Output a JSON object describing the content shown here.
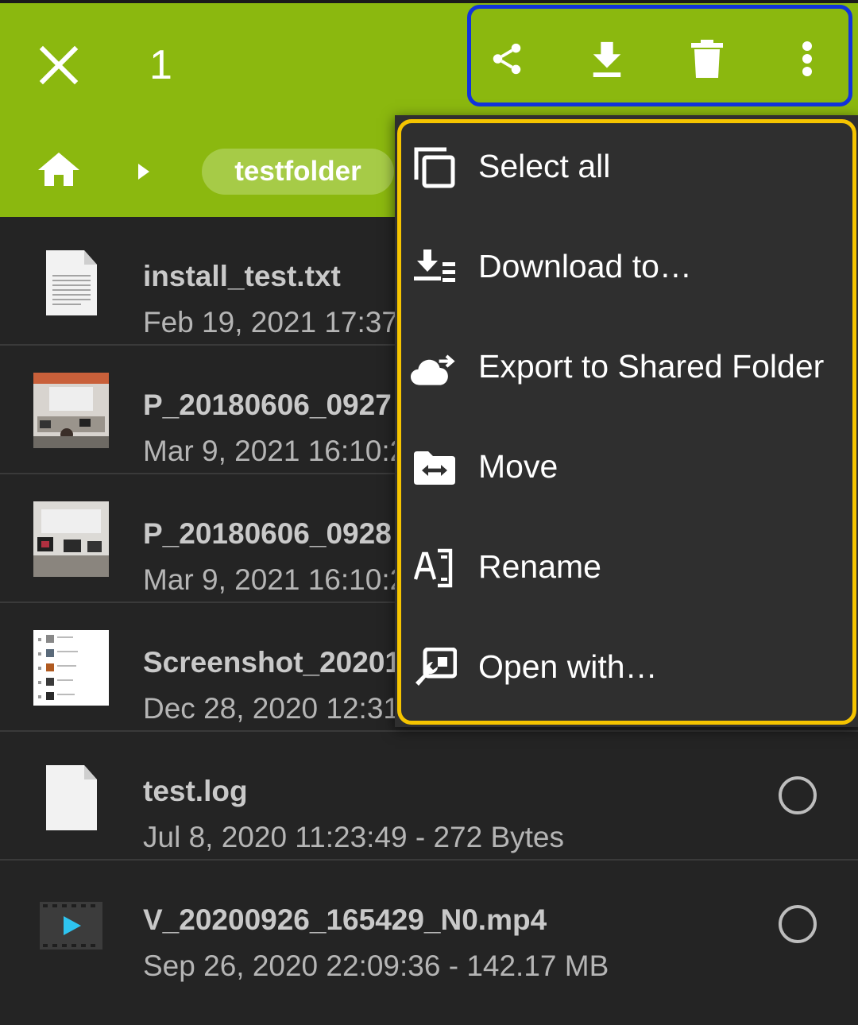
{
  "header": {
    "selected_count": "1",
    "breadcrumb_folder": "testfolder"
  },
  "colors": {
    "appbar": "#8bb80f",
    "background": "#242424",
    "menu_bg": "#2f2f2f",
    "highlight_actions": "#1133dd",
    "highlight_menu": "#f5c400"
  },
  "actions": [
    {
      "icon": "share-icon"
    },
    {
      "icon": "download-icon"
    },
    {
      "icon": "trash-icon"
    },
    {
      "icon": "more-vert-icon"
    }
  ],
  "files": [
    {
      "name": "install_test.txt",
      "meta": "Feb 19, 2021 17:37",
      "icon": "text-file-icon"
    },
    {
      "name": "P_20180606_0927",
      "meta": "Mar 9, 2021 16:10:2",
      "icon": "photo-thumbnail"
    },
    {
      "name": "P_20180606_0928",
      "meta": "Mar 9, 2021 16:10:2",
      "icon": "photo-thumbnail"
    },
    {
      "name": "Screenshot_20201",
      "meta": "Dec 28, 2020 12:31",
      "icon": "screenshot-thumbnail"
    },
    {
      "name": "test.log",
      "meta": "Jul 8, 2020 11:23:49 - 272 Bytes",
      "icon": "blank-file-icon"
    },
    {
      "name": "V_20200926_165429_N0.mp4",
      "meta": "Sep 26, 2020 22:09:36 - 142.17 MB",
      "icon": "video-file-icon"
    }
  ],
  "menu": [
    {
      "label": "Select all",
      "icon": "select-all-icon"
    },
    {
      "label": "Download to…",
      "icon": "download-to-icon"
    },
    {
      "label": "Export to Shared Folder",
      "icon": "cloud-export-icon"
    },
    {
      "label": "Move",
      "icon": "move-folder-icon"
    },
    {
      "label": "Rename",
      "icon": "rename-icon"
    },
    {
      "label": "Open with…",
      "icon": "open-with-icon"
    }
  ]
}
